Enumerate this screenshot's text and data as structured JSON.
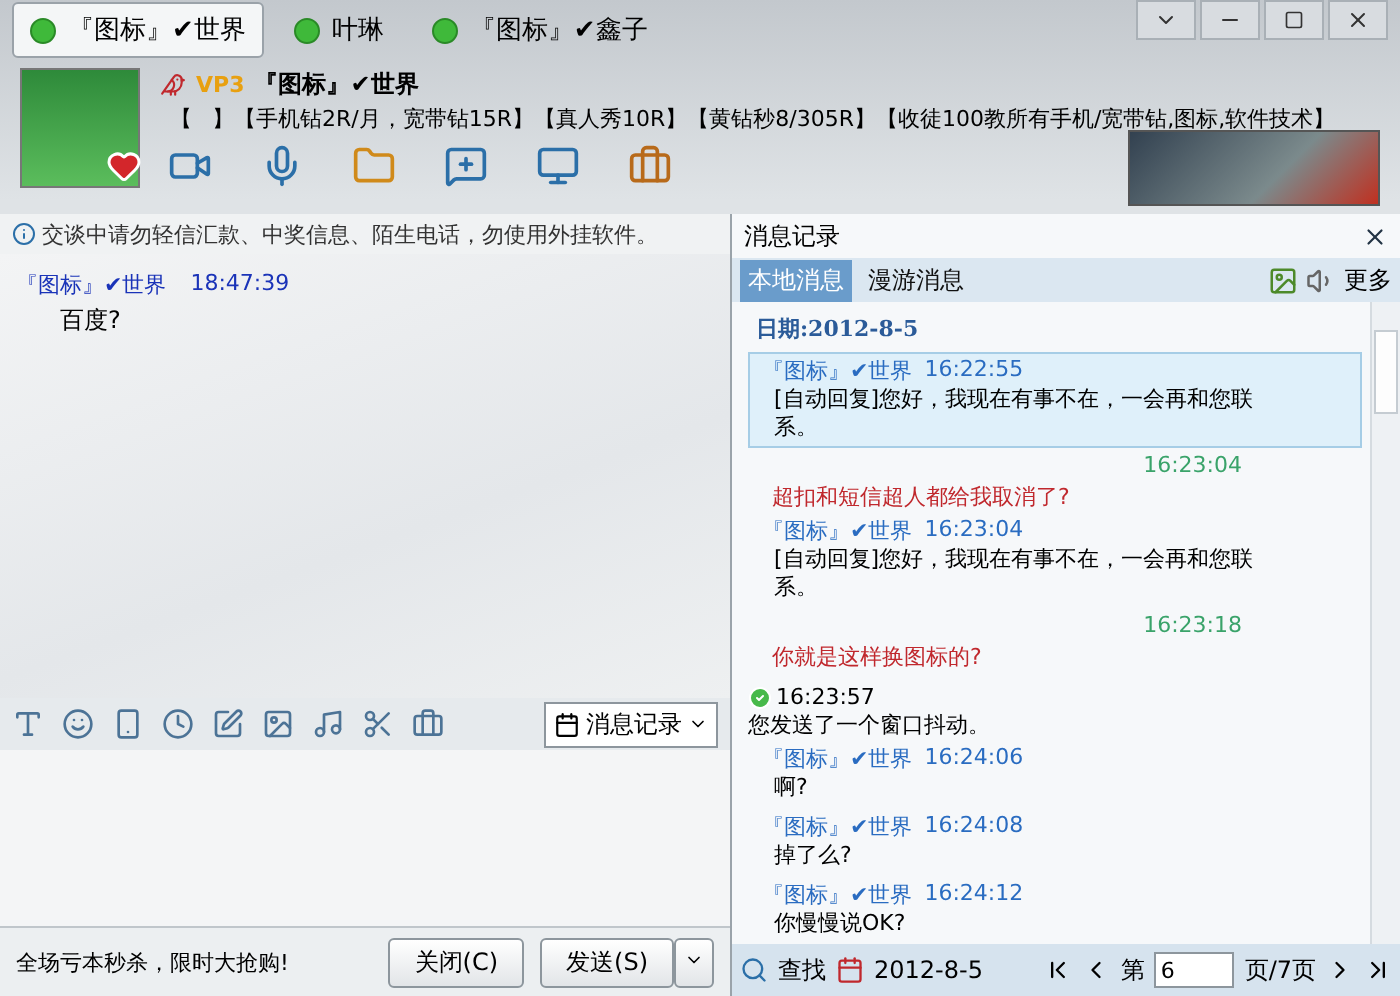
{
  "window": {
    "tabs": [
      {
        "label": "『图标』✔世界",
        "selected": true
      },
      {
        "label": "叶琳",
        "selected": false
      },
      {
        "label": "『图标』✔鑫子",
        "selected": false
      }
    ]
  },
  "profile": {
    "vip": "VP3",
    "nickname": "『图标』✔世界",
    "signature_open": "【",
    "signature_rest": "】【手机钻2R/月，宽带钻15R】【真人秀10R】【黄钻秒8/305R】【收徒100教所有手机/宽带钻,图标,软件技术】"
  },
  "notice": "交谈中请勿轻信汇款、中奖信息、陌生电话，勿使用外挂软件。",
  "chat": [
    {
      "sender": "『图标』✔世界",
      "time": "18:47:39",
      "text": "百度?"
    }
  ],
  "input": {
    "history_button": "消息记录"
  },
  "bottom": {
    "promo": "全场亏本秒杀，限时大抢购!",
    "close_button": "关闭(C)",
    "send_button": "发送(S)"
  },
  "history": {
    "title": "消息记录",
    "tabs": [
      {
        "label": "本地消息",
        "selected": true
      },
      {
        "label": "漫游消息",
        "selected": false
      }
    ],
    "more": "更多",
    "entries": [
      {
        "kind": "date",
        "text": "日期:2012-8-5"
      },
      {
        "kind": "incoming",
        "sender": "『图标』✔世界",
        "time": "16:22:55",
        "text": "[自动回复]您好，我现在有事不在，一会再和您联系。",
        "selected": true
      },
      {
        "kind": "outgoing",
        "time": "16:23:04",
        "text": "超扣和短信超人都给我取消了?"
      },
      {
        "kind": "incoming",
        "sender": "『图标』✔世界",
        "time": "16:23:04",
        "text": "[自动回复]您好，我现在有事不在，一会再和您联系。",
        "selected": false
      },
      {
        "kind": "outgoing",
        "time": "16:23:18",
        "text": "你就是这样换图标的?"
      },
      {
        "kind": "system",
        "time": "16:23:57",
        "text": "您发送了一个窗口抖动。"
      },
      {
        "kind": "incoming",
        "sender": "『图标』✔世界",
        "time": "16:24:06",
        "text": "啊?",
        "selected": false
      },
      {
        "kind": "incoming",
        "sender": "『图标』✔世界",
        "time": "16:24:08",
        "text": "掉了么?",
        "selected": false
      },
      {
        "kind": "incoming",
        "sender": "『图标』✔世界",
        "time": "16:24:12",
        "text": "你慢慢说OK?",
        "selected": false
      }
    ],
    "footer": {
      "search": "查找",
      "date": "2012-8-5",
      "page_prefix": "第",
      "page": "6",
      "page_suffix": "页/7页"
    }
  }
}
